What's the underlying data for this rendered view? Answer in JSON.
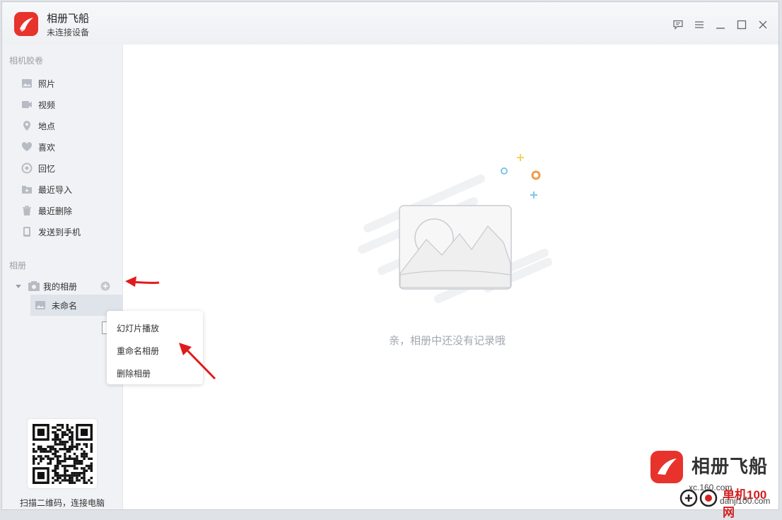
{
  "app": {
    "title": "相册飞船",
    "subtitle": "未连接设备"
  },
  "sidebar": {
    "camera_roll_label": "相机胶卷",
    "items": [
      {
        "label": "照片",
        "icon": "image-icon"
      },
      {
        "label": "视频",
        "icon": "video-icon"
      },
      {
        "label": "地点",
        "icon": "location-pin-icon"
      },
      {
        "label": "喜欢",
        "icon": "heart-icon"
      },
      {
        "label": "回忆",
        "icon": "memory-ring-icon"
      },
      {
        "label": "最近导入",
        "icon": "folder-import-icon"
      },
      {
        "label": "最近删除",
        "icon": "trash-icon"
      },
      {
        "label": "发送到手机",
        "icon": "phone-icon"
      }
    ],
    "albums_label": "相册",
    "my_albums": "我的相册",
    "untitled_album": "未命名",
    "qr_caption": "扫描二维码，连接电脑"
  },
  "main": {
    "empty_text": "亲，相册中还没有记录哦"
  },
  "context_menu": {
    "items": [
      "幻灯片播放",
      "重命名相册",
      "删除相册"
    ]
  },
  "watermark": {
    "name": "相册飞船",
    "cn": "单机100网",
    "site_a": "xc.160.com",
    "site_b": "danji100.com"
  },
  "colors": {
    "brand": "#e8322c",
    "annotation": "#e11b1b"
  }
}
